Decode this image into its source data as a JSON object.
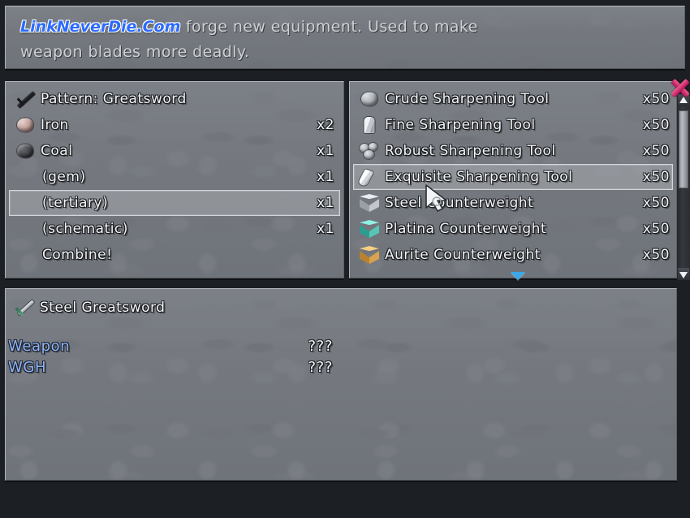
{
  "header": {
    "watermark": "LinkNeverDie.Com",
    "description_line_1": "forge new equipment.  Used to make",
    "description_line_2": "weapon blades more deadly."
  },
  "recipe_panel": {
    "rows": [
      {
        "label": "Pattern: Greatsword",
        "qty": "",
        "icon": "dark-sword-icon",
        "selected": false
      },
      {
        "label": "Iron",
        "qty": "x2",
        "icon": "iron-ore-icon",
        "selected": false
      },
      {
        "label": "Coal",
        "qty": "x1",
        "icon": "coal-ore-icon",
        "selected": false
      },
      {
        "label": "(gem)",
        "qty": "x1",
        "icon": "",
        "selected": false
      },
      {
        "label": "(tertiary)",
        "qty": "x1",
        "icon": "",
        "selected": true
      },
      {
        "label": "(schematic)",
        "qty": "x1",
        "icon": "",
        "selected": false
      },
      {
        "label": "Combine!",
        "qty": "",
        "icon": "",
        "selected": false
      }
    ]
  },
  "items_panel": {
    "rows": [
      {
        "label": "Crude Sharpening Tool",
        "qty": "x50",
        "icon": "gray-rock-icon",
        "selected": false
      },
      {
        "label": "Fine Sharpening Tool",
        "qty": "x50",
        "icon": "whetstone-icon",
        "selected": false
      },
      {
        "label": "Robust Sharpening Tool",
        "qty": "x50",
        "icon": "rock-cluster-icon",
        "selected": false
      },
      {
        "label": "Exquisite Sharpening Tool",
        "qty": "x50",
        "icon": "white-wedge-icon",
        "selected": true
      },
      {
        "label": "Steel Counterweight",
        "qty": "x50",
        "icon": "steel-cube-icon",
        "selected": false
      },
      {
        "label": "Platina Counterweight",
        "qty": "x50",
        "icon": "platina-cube-icon",
        "selected": false
      },
      {
        "label": "Aurite Counterweight",
        "qty": "x50",
        "icon": "aurite-cube-icon",
        "selected": false
      }
    ],
    "more_indicator": "scroll-down-triangle"
  },
  "detail_panel": {
    "item_name": "Steel Greatsword",
    "item_icon": "steel-sword-icon",
    "stats": [
      {
        "label": "Weapon",
        "value": "???"
      },
      {
        "label": "WGH",
        "value": "???"
      }
    ]
  },
  "controls": {
    "close_label": "close-button",
    "scroll_up": "scroll-up-arrow",
    "scroll_down": "scroll-down-arrow"
  },
  "colors": {
    "panel": "#767a80",
    "accent_blue": "#2b6bff",
    "stat_label_blue": "#8fb4f5",
    "close_pink": "#e0407e",
    "indicator_blue": "#3ba7e8"
  }
}
